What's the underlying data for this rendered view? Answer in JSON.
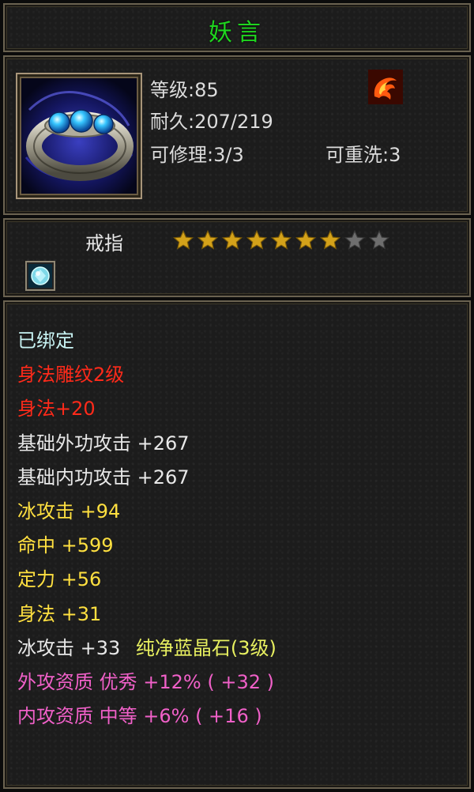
{
  "item": {
    "name": "妖言",
    "icon": "ring-with-blue-gems-icon",
    "level_text": "等级:85",
    "durability_text": "耐久:207/219",
    "repairable_text": "可修理:3/3",
    "rewash_text": "可重洗:3",
    "element_icon": "fire-swirl-icon",
    "type": "戒指",
    "stars_filled": 7,
    "stars_total": 9,
    "gem_icon": "blue-crystal-gem-icon"
  },
  "attributes": {
    "bound": "已绑定",
    "engrave": "身法雕纹2级",
    "engrave_bonus": "身法+20",
    "base_outer": "基础外功攻击  +267",
    "base_inner": "基础内功攻击  +267",
    "ice_attack": "冰攻击  +94",
    "hit": "命中  +599",
    "focus": "定力  +56",
    "agility": "身法  +31",
    "gem_bonus_value": "冰攻击  +33",
    "gem_bonus_name": "纯净蓝晶石(3级)",
    "outer_quality": "外攻资质   优秀  +12% ( +32 )",
    "inner_quality": "内攻资质   中等  +6% ( +16 )"
  },
  "colors": {
    "title": "#1fd51f",
    "bound": "#c8f4f4",
    "engrave": "#ff2a1a",
    "base": "#e8e8e8",
    "blue_attr": "#ffe040",
    "quality": "#f060c8",
    "star_filled": "#d4a21a",
    "star_empty": "#6e6e6e"
  }
}
